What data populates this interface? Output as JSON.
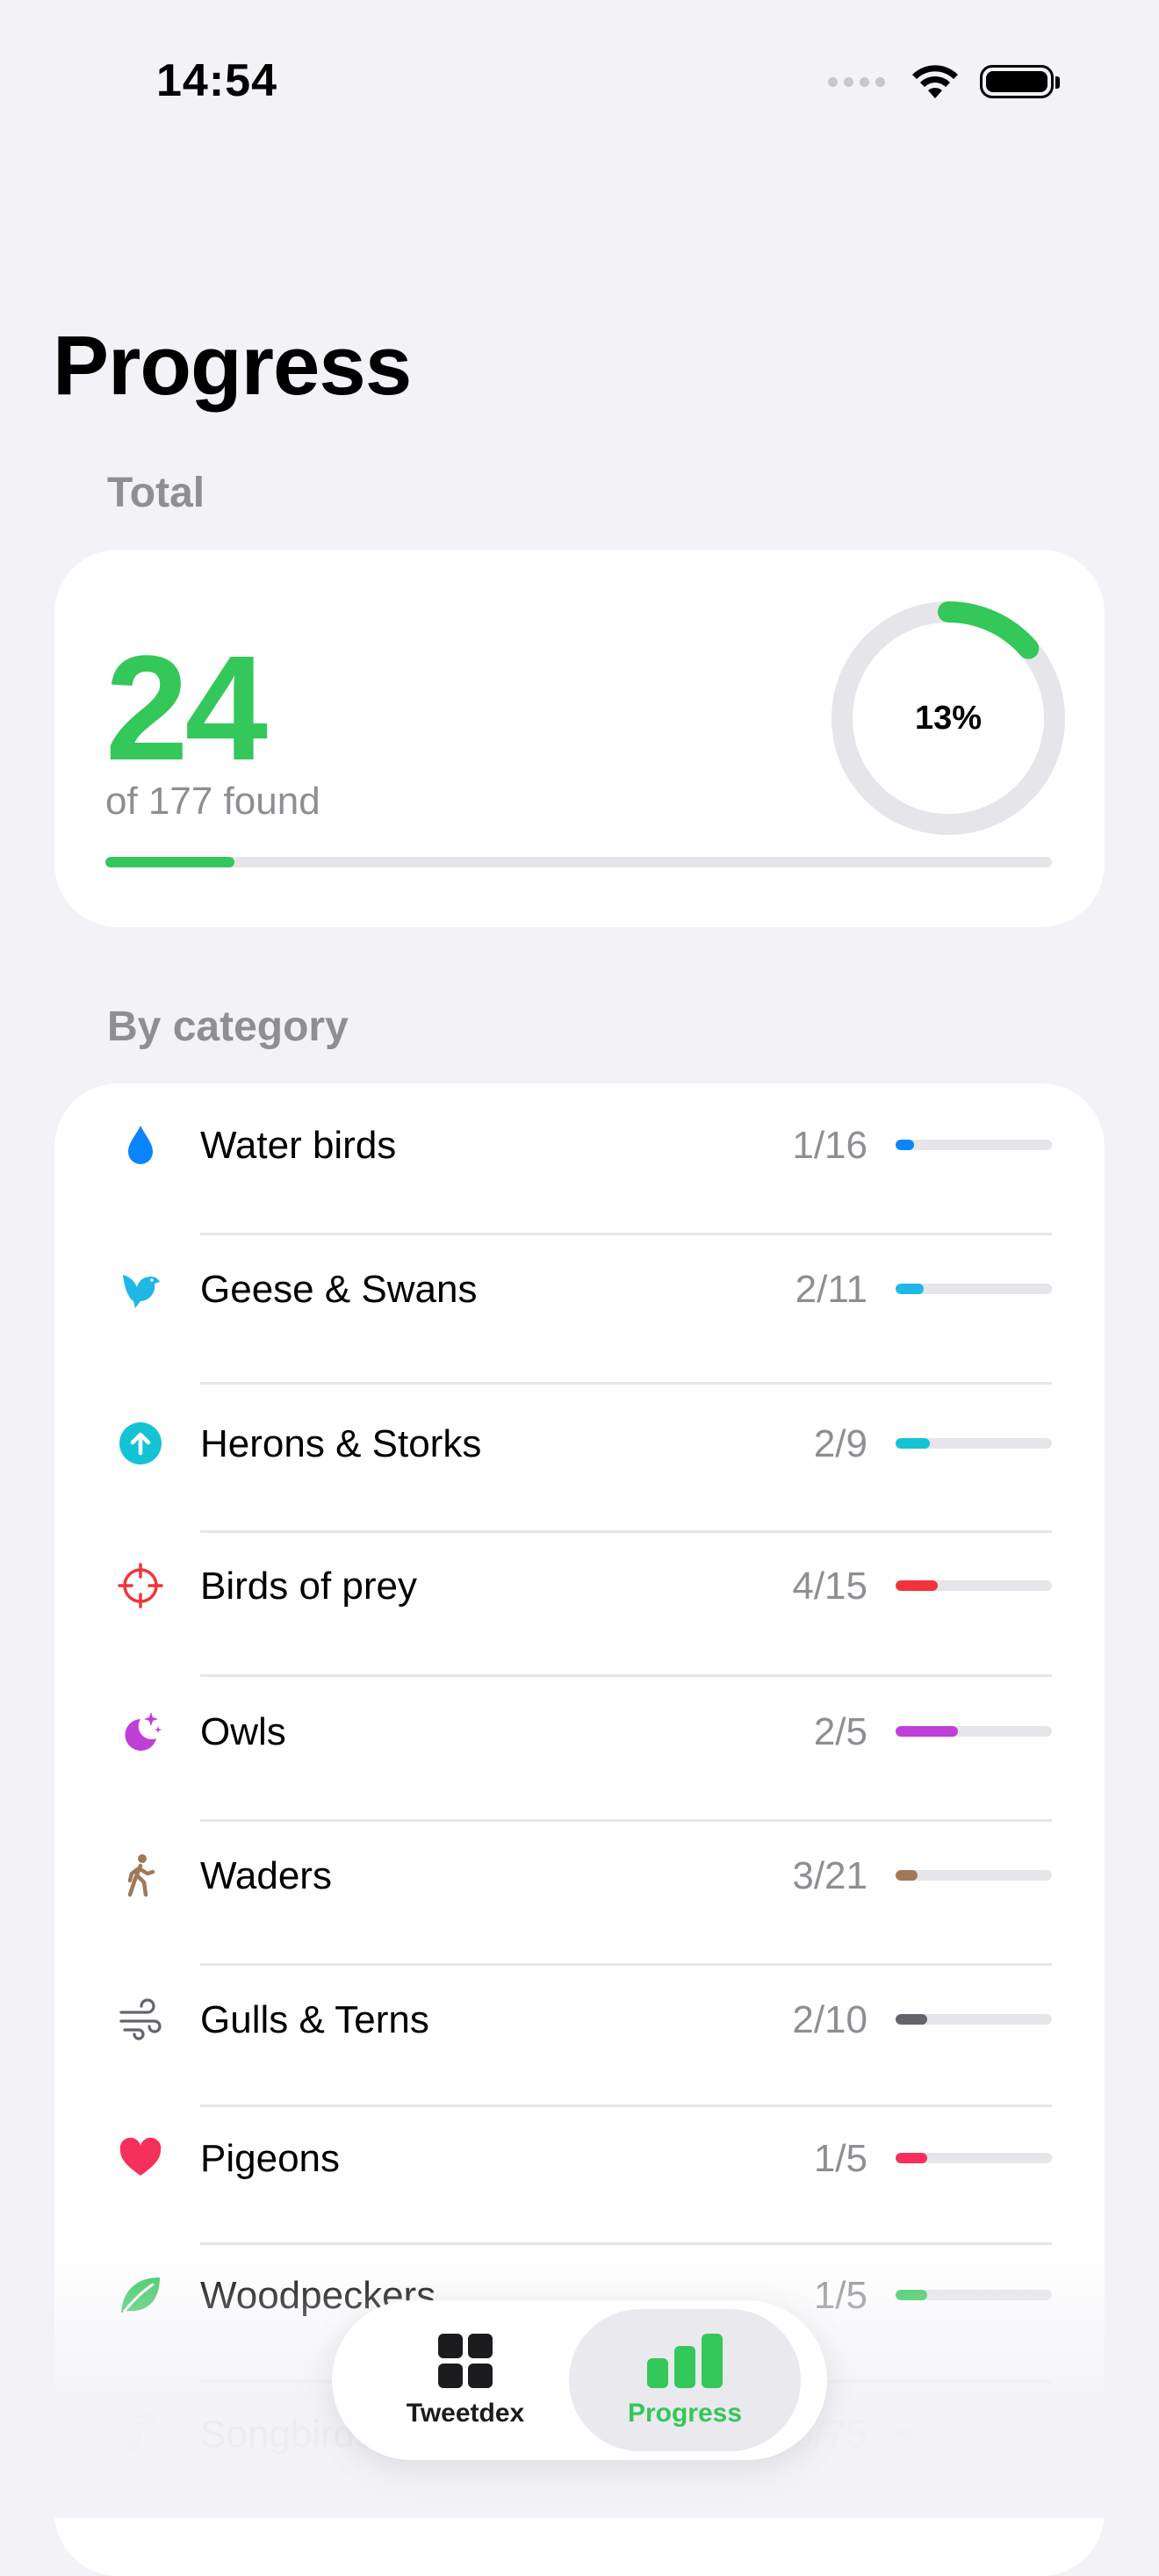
{
  "status_bar": {
    "time": "14:54"
  },
  "page": {
    "title": "Progress"
  },
  "total": {
    "section_label": "Total",
    "found": 24,
    "total_count": 177,
    "found_text": "of 177 found",
    "percent_label": "13%",
    "progress": 0.136,
    "accent_color": "#34C759"
  },
  "categories_section": {
    "label": "By category",
    "items": [
      {
        "name": "Water birds",
        "count": "1/16",
        "progress": 0.0625,
        "color": "#0A84FF",
        "icon": "drop-icon"
      },
      {
        "name": "Geese & Swans",
        "count": "2/11",
        "progress": 0.18,
        "color": "#1FB8E6",
        "icon": "bird-icon"
      },
      {
        "name": "Herons & Storks",
        "count": "2/9",
        "progress": 0.22,
        "color": "#14C3D4",
        "icon": "arrow-up-circle-icon"
      },
      {
        "name": "Birds of prey",
        "count": "4/15",
        "progress": 0.27,
        "color": "#F2343A",
        "icon": "scope-icon"
      },
      {
        "name": "Owls",
        "count": "2/5",
        "progress": 0.4,
        "color": "#BF3FD8",
        "icon": "moon-stars-icon"
      },
      {
        "name": "Waders",
        "count": "3/21",
        "progress": 0.14,
        "color": "#A2785A",
        "icon": "walking-icon"
      },
      {
        "name": "Gulls & Terns",
        "count": "2/10",
        "progress": 0.2,
        "color": "#63636E",
        "icon": "wind-icon"
      },
      {
        "name": "Pigeons",
        "count": "1/5",
        "progress": 0.2,
        "color": "#F5305A",
        "icon": "heart-icon"
      },
      {
        "name": "Woodpeckers",
        "count": "1/5",
        "progress": 0.2,
        "color": "#34C759",
        "icon": "leaf-icon"
      },
      {
        "name": "Songbirds",
        "count": "3/75",
        "progress": 0.04,
        "color": "#F2B28A",
        "icon": "music-note-icon"
      }
    ]
  },
  "tab_bar": {
    "tabs": [
      {
        "label": "Tweetdex",
        "icon": "grid-icon",
        "active": false
      },
      {
        "label": "Progress",
        "icon": "bar-chart-icon",
        "active": true
      }
    ]
  }
}
